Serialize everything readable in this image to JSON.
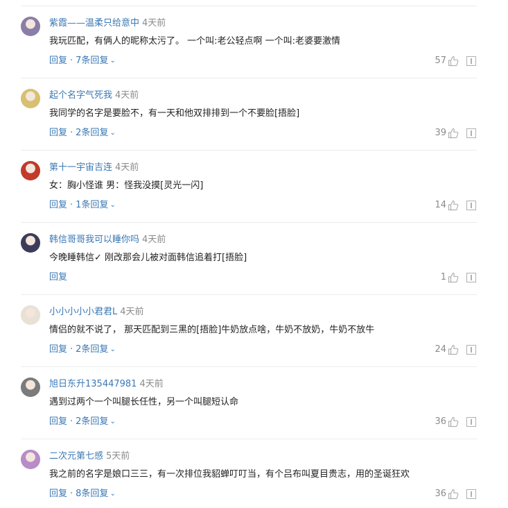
{
  "comments": [
    {
      "username": "紫霞——温柔只给意中",
      "time": "4天前",
      "content": "我玩匹配，有俩人的昵称太污了。 一个叫:老公轻点啊 一个叫:老婆要激情",
      "reply_label": "回复",
      "dot": "·",
      "expand_label": "7条回复",
      "likes": "57",
      "avatar_color": "#8a7ea8"
    },
    {
      "username": "起个名字气死我",
      "time": "4天前",
      "content": "我同学的名字是要脸不，有一天和他双排排到一个不要脸[捂脸]",
      "reply_label": "回复",
      "dot": "·",
      "expand_label": "2条回复",
      "likes": "39",
      "avatar_color": "#d8c070"
    },
    {
      "username": "第十一宇宙吉连",
      "time": "4天前",
      "content": "女：胸小怪谁 男：怪我没摸[灵光一闪]",
      "reply_label": "回复",
      "dot": "·",
      "expand_label": "1条回复",
      "likes": "14",
      "avatar_color": "#c23a2a"
    },
    {
      "username": "韩信哥哥我可以睡你吗",
      "time": "4天前",
      "content": "今晚睡韩信✓ 刚改那会儿被对面韩信追着打[捂脸]",
      "reply_label": "回复",
      "dot": "",
      "expand_label": "",
      "likes": "1",
      "avatar_color": "#3c3c5a"
    },
    {
      "username": "小小小小小君君L",
      "time": "4天前",
      "content": "情侣的就不说了， 那天匹配到三黑的[捂脸]牛奶放点啥，牛奶不放奶，牛奶不放牛",
      "reply_label": "回复",
      "dot": "·",
      "expand_label": "2条回复",
      "likes": "24",
      "avatar_color": "#e9e1d6"
    },
    {
      "username": "旭日东升135447981",
      "time": "4天前",
      "content": "遇到过两个一个叫腿长任性，另一个叫腿短认命",
      "reply_label": "回复",
      "dot": "·",
      "expand_label": "2条回复",
      "likes": "36",
      "avatar_color": "#7b7b7b"
    },
    {
      "username": "二次元第七感",
      "time": "5天前",
      "content": "我之前的名字是娘口三三，有一次排位我貂蝉叮叮当，有个吕布叫夏目贵志，用的圣诞狂欢",
      "reply_label": "回复",
      "dot": "·",
      "expand_label": "8条回复",
      "likes": "36",
      "avatar_color": "#b78cc7"
    }
  ],
  "icons": {
    "expand": "chevron-down-icon",
    "like": "thumbs-up-icon",
    "report": "report-icon"
  },
  "colors": {
    "link": "#3a78b5",
    "muted": "#8a8a8a",
    "text": "#222222",
    "divider": "#ececec"
  }
}
